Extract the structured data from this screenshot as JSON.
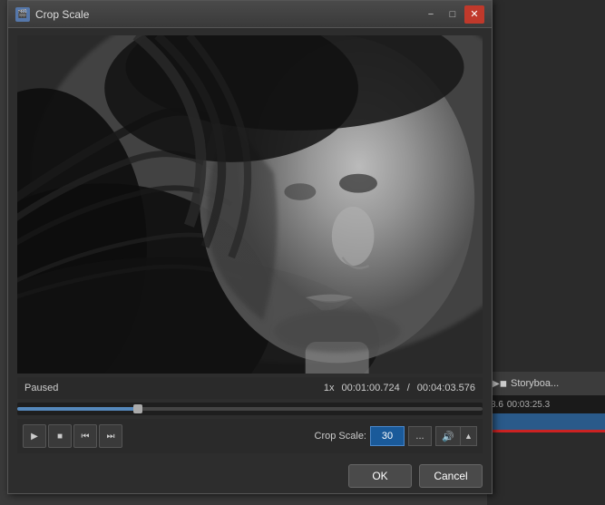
{
  "window": {
    "title": "Crop Scale",
    "app_icon": "🎬"
  },
  "titlebar": {
    "minimize_label": "−",
    "maximize_label": "□",
    "close_label": "✕"
  },
  "status": {
    "state": "Paused",
    "speed": "1x",
    "current_time": "00:01:00.724",
    "total_time": "00:04:03.576",
    "separator": "/"
  },
  "crop_scale": {
    "label": "Crop Scale:",
    "value": "30",
    "dots_label": "...",
    "volume_icon": "🔊",
    "arrow_icon": "▲"
  },
  "transport": {
    "play_icon": "▶",
    "stop_icon": "■",
    "prev_icon": "⏮",
    "next_icon": "⏭"
  },
  "buttons": {
    "ok_label": "OK",
    "cancel_label": "Cancel"
  },
  "storyboard": {
    "icon": "▶◼",
    "label": "Storyboa..."
  },
  "timeline": {
    "time": "3.6",
    "time2": "00:03:25.3"
  },
  "scrubber": {
    "fill_percent": 26
  }
}
